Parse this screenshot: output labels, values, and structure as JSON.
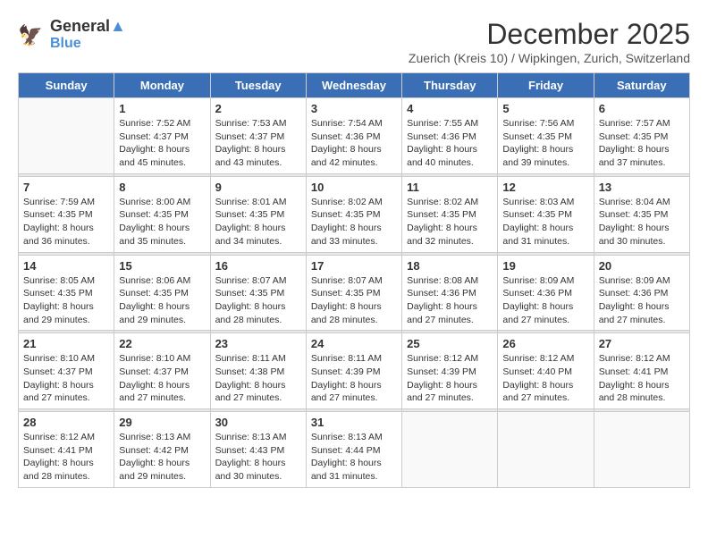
{
  "logo": {
    "line1": "General",
    "line2": "Blue"
  },
  "title": "December 2025",
  "subtitle": "Zuerich (Kreis 10) / Wipkingen, Zurich, Switzerland",
  "weekdays": [
    "Sunday",
    "Monday",
    "Tuesday",
    "Wednesday",
    "Thursday",
    "Friday",
    "Saturday"
  ],
  "weeks": [
    [
      {
        "day": "",
        "info": ""
      },
      {
        "day": "1",
        "info": "Sunrise: 7:52 AM\nSunset: 4:37 PM\nDaylight: 8 hours\nand 45 minutes."
      },
      {
        "day": "2",
        "info": "Sunrise: 7:53 AM\nSunset: 4:37 PM\nDaylight: 8 hours\nand 43 minutes."
      },
      {
        "day": "3",
        "info": "Sunrise: 7:54 AM\nSunset: 4:36 PM\nDaylight: 8 hours\nand 42 minutes."
      },
      {
        "day": "4",
        "info": "Sunrise: 7:55 AM\nSunset: 4:36 PM\nDaylight: 8 hours\nand 40 minutes."
      },
      {
        "day": "5",
        "info": "Sunrise: 7:56 AM\nSunset: 4:35 PM\nDaylight: 8 hours\nand 39 minutes."
      },
      {
        "day": "6",
        "info": "Sunrise: 7:57 AM\nSunset: 4:35 PM\nDaylight: 8 hours\nand 37 minutes."
      }
    ],
    [
      {
        "day": "7",
        "info": "Sunrise: 7:59 AM\nSunset: 4:35 PM\nDaylight: 8 hours\nand 36 minutes."
      },
      {
        "day": "8",
        "info": "Sunrise: 8:00 AM\nSunset: 4:35 PM\nDaylight: 8 hours\nand 35 minutes."
      },
      {
        "day": "9",
        "info": "Sunrise: 8:01 AM\nSunset: 4:35 PM\nDaylight: 8 hours\nand 34 minutes."
      },
      {
        "day": "10",
        "info": "Sunrise: 8:02 AM\nSunset: 4:35 PM\nDaylight: 8 hours\nand 33 minutes."
      },
      {
        "day": "11",
        "info": "Sunrise: 8:02 AM\nSunset: 4:35 PM\nDaylight: 8 hours\nand 32 minutes."
      },
      {
        "day": "12",
        "info": "Sunrise: 8:03 AM\nSunset: 4:35 PM\nDaylight: 8 hours\nand 31 minutes."
      },
      {
        "day": "13",
        "info": "Sunrise: 8:04 AM\nSunset: 4:35 PM\nDaylight: 8 hours\nand 30 minutes."
      }
    ],
    [
      {
        "day": "14",
        "info": "Sunrise: 8:05 AM\nSunset: 4:35 PM\nDaylight: 8 hours\nand 29 minutes."
      },
      {
        "day": "15",
        "info": "Sunrise: 8:06 AM\nSunset: 4:35 PM\nDaylight: 8 hours\nand 29 minutes."
      },
      {
        "day": "16",
        "info": "Sunrise: 8:07 AM\nSunset: 4:35 PM\nDaylight: 8 hours\nand 28 minutes."
      },
      {
        "day": "17",
        "info": "Sunrise: 8:07 AM\nSunset: 4:35 PM\nDaylight: 8 hours\nand 28 minutes."
      },
      {
        "day": "18",
        "info": "Sunrise: 8:08 AM\nSunset: 4:36 PM\nDaylight: 8 hours\nand 27 minutes."
      },
      {
        "day": "19",
        "info": "Sunrise: 8:09 AM\nSunset: 4:36 PM\nDaylight: 8 hours\nand 27 minutes."
      },
      {
        "day": "20",
        "info": "Sunrise: 8:09 AM\nSunset: 4:36 PM\nDaylight: 8 hours\nand 27 minutes."
      }
    ],
    [
      {
        "day": "21",
        "info": "Sunrise: 8:10 AM\nSunset: 4:37 PM\nDaylight: 8 hours\nand 27 minutes."
      },
      {
        "day": "22",
        "info": "Sunrise: 8:10 AM\nSunset: 4:37 PM\nDaylight: 8 hours\nand 27 minutes."
      },
      {
        "day": "23",
        "info": "Sunrise: 8:11 AM\nSunset: 4:38 PM\nDaylight: 8 hours\nand 27 minutes."
      },
      {
        "day": "24",
        "info": "Sunrise: 8:11 AM\nSunset: 4:39 PM\nDaylight: 8 hours\nand 27 minutes."
      },
      {
        "day": "25",
        "info": "Sunrise: 8:12 AM\nSunset: 4:39 PM\nDaylight: 8 hours\nand 27 minutes."
      },
      {
        "day": "26",
        "info": "Sunrise: 8:12 AM\nSunset: 4:40 PM\nDaylight: 8 hours\nand 27 minutes."
      },
      {
        "day": "27",
        "info": "Sunrise: 8:12 AM\nSunset: 4:41 PM\nDaylight: 8 hours\nand 28 minutes."
      }
    ],
    [
      {
        "day": "28",
        "info": "Sunrise: 8:12 AM\nSunset: 4:41 PM\nDaylight: 8 hours\nand 28 minutes."
      },
      {
        "day": "29",
        "info": "Sunrise: 8:13 AM\nSunset: 4:42 PM\nDaylight: 8 hours\nand 29 minutes."
      },
      {
        "day": "30",
        "info": "Sunrise: 8:13 AM\nSunset: 4:43 PM\nDaylight: 8 hours\nand 30 minutes."
      },
      {
        "day": "31",
        "info": "Sunrise: 8:13 AM\nSunset: 4:44 PM\nDaylight: 8 hours\nand 31 minutes."
      },
      {
        "day": "",
        "info": ""
      },
      {
        "day": "",
        "info": ""
      },
      {
        "day": "",
        "info": ""
      }
    ]
  ]
}
